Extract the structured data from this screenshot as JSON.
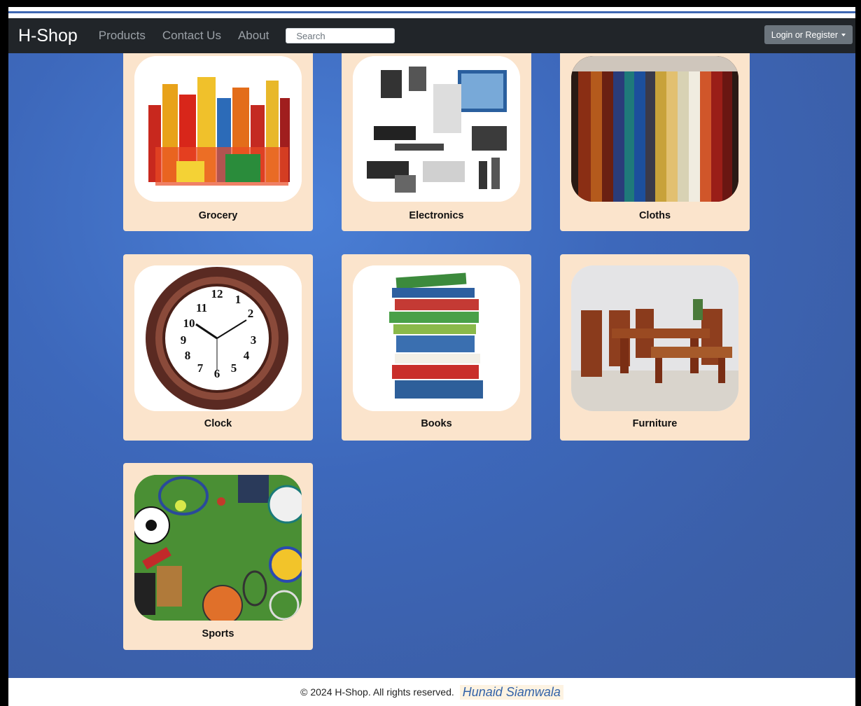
{
  "navbar": {
    "brand": "H-Shop",
    "links": [
      "Products",
      "Contact Us",
      "About"
    ],
    "search_placeholder": "Search",
    "login_label": "Login or Register"
  },
  "categories": [
    {
      "label": "Grocery"
    },
    {
      "label": "Electronics"
    },
    {
      "label": "Cloths"
    },
    {
      "label": "Clock"
    },
    {
      "label": "Books"
    },
    {
      "label": "Furniture"
    },
    {
      "label": "Sports"
    }
  ],
  "footer": {
    "copyright": "© 2024 H-Shop. All rights reserved.",
    "author": "Hunaid Siamwala"
  },
  "colors": {
    "navbar_bg": "#212529",
    "card_bg": "#fbe4cc",
    "main_bg": "#3d68bb"
  }
}
